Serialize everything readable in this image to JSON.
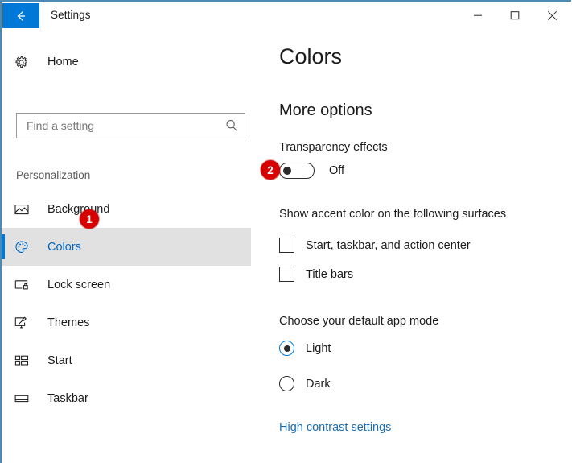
{
  "window": {
    "title": "Settings",
    "accent_color": "#0078d7",
    "border_color": "#4a8ab5",
    "back_icon": "back-arrow-icon",
    "controls": {
      "minimize": "minimize-icon",
      "maximize": "maximize-icon",
      "close": "close-icon"
    }
  },
  "sidebar": {
    "home": {
      "label": "Home",
      "icon": "gear-icon"
    },
    "search": {
      "value": "",
      "placeholder": "Find a setting",
      "icon": "search-icon"
    },
    "section_label": "Personalization",
    "items": [
      {
        "label": "Background",
        "icon": "picture-icon",
        "selected": false
      },
      {
        "label": "Colors",
        "icon": "palette-icon",
        "selected": true,
        "badge": "1"
      },
      {
        "label": "Lock screen",
        "icon": "lock-screen-icon",
        "selected": false
      },
      {
        "label": "Themes",
        "icon": "brush-monitor-icon",
        "selected": false
      },
      {
        "label": "Start",
        "icon": "start-tiles-icon",
        "selected": false
      },
      {
        "label": "Taskbar",
        "icon": "taskbar-icon",
        "selected": false
      }
    ]
  },
  "content": {
    "page_title": "Colors",
    "more_options_heading": "More options",
    "transparency": {
      "label": "Transparency effects",
      "state": "Off",
      "checked": false,
      "badge": "2"
    },
    "accent_surfaces": {
      "heading": "Show accent color on the following surfaces",
      "options": [
        {
          "label": "Start, taskbar, and action center",
          "checked": false
        },
        {
          "label": "Title bars",
          "checked": false
        }
      ]
    },
    "app_mode": {
      "heading": "Choose your default app mode",
      "options": [
        {
          "label": "Light",
          "checked": true
        },
        {
          "label": "Dark",
          "checked": false
        }
      ]
    },
    "high_contrast_link": "High contrast settings"
  },
  "annotations": {
    "badge_color": "#d60000",
    "markers": [
      {
        "number": "1",
        "target": "sidebar-item-colors"
      },
      {
        "number": "2",
        "target": "transparency-effects-toggle"
      }
    ]
  }
}
